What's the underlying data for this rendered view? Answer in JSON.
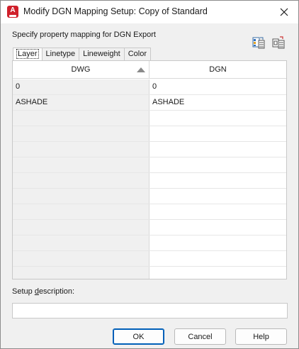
{
  "window": {
    "title": "Modify DGN Mapping Setup: Copy of Standard",
    "app_icon": "autocad-logo-icon",
    "close_icon": "close-icon"
  },
  "prompt": "Specify property mapping for DGN Export",
  "toolbar": {
    "icons": [
      "mapping-table-icon",
      "dgn-export-icon"
    ]
  },
  "tabs": [
    {
      "label": "Layer",
      "active": true
    },
    {
      "label": "Linetype",
      "active": false
    },
    {
      "label": "Lineweight",
      "active": false
    },
    {
      "label": "Color",
      "active": false
    }
  ],
  "grid": {
    "columns": [
      "DWG",
      "DGN"
    ],
    "sort_column": "DWG",
    "sort_direction": "ascending",
    "rows": [
      {
        "dwg": "0",
        "dgn": "0"
      },
      {
        "dwg": "ASHADE",
        "dgn": "ASHADE"
      },
      {
        "dwg": "",
        "dgn": ""
      },
      {
        "dwg": "",
        "dgn": ""
      },
      {
        "dwg": "",
        "dgn": ""
      },
      {
        "dwg": "",
        "dgn": ""
      },
      {
        "dwg": "",
        "dgn": ""
      },
      {
        "dwg": "",
        "dgn": ""
      },
      {
        "dwg": "",
        "dgn": ""
      },
      {
        "dwg": "",
        "dgn": ""
      },
      {
        "dwg": "",
        "dgn": ""
      },
      {
        "dwg": "",
        "dgn": ""
      },
      {
        "dwg": "",
        "dgn": ""
      }
    ]
  },
  "description": {
    "label_pre": "Setup ",
    "label_mnemonic": "d",
    "label_post": "escription:",
    "value": ""
  },
  "buttons": {
    "ok": "OK",
    "cancel": "Cancel",
    "help": "Help"
  },
  "colors": {
    "accent": "#005fb8",
    "app_icon_red": "#d0202b"
  }
}
